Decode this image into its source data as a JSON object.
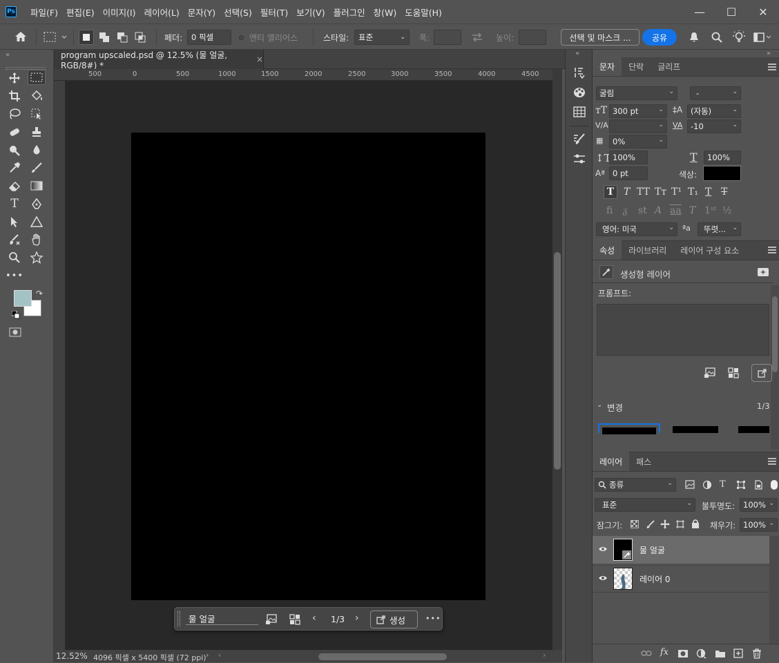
{
  "app": {
    "logo": "Ps"
  },
  "menu": [
    "파일(F)",
    "편집(E)",
    "이미지(I)",
    "레이어(L)",
    "문자(Y)",
    "선택(S)",
    "필터(T)",
    "보기(V)",
    "플러그인",
    "창(W)",
    "도움말(H)"
  ],
  "window": {
    "minimize": "—",
    "maximize": "☐",
    "close": "✕"
  },
  "options": {
    "feather_label": "페더:",
    "feather_value": "0 픽셀",
    "antialias_label": "앤티 앨리어스",
    "style_label": "스타일:",
    "style_value": "표준",
    "width_label": "폭:",
    "height_label": "높이:",
    "select_mask": "선택 및 마스크 ...",
    "share": "공유"
  },
  "document": {
    "tab_title": "program upscaled.psd @ 12.5% (물 얼굴, RGB/8#) *",
    "ruler_ticks": [
      "500",
      "0",
      "500",
      "1000",
      "1500",
      "2000",
      "2500",
      "3000",
      "3500",
      "4000",
      "4500"
    ],
    "zoom": "12.52%",
    "info": "4096 픽셀 x 5400 픽셀 (72 ppi)"
  },
  "contextual_bar": {
    "prompt": "물 얼굴",
    "pager": "1/3",
    "generate": "생성",
    "more": "•••"
  },
  "type_panel": {
    "tabs": [
      "문자",
      "단락",
      "글리프"
    ],
    "font_family": "굴림",
    "font_style": "-",
    "size": "300 pt",
    "leading": "(자동)",
    "kerning": "",
    "tracking": "-10",
    "tsume": "0%",
    "vscale": "100%",
    "hscale": "100%",
    "baseline": "0 pt",
    "color_label": "색상:",
    "color": "#000000",
    "language": "영어: 미국",
    "antialias_glyph": "ªa",
    "antialias": "뚜렷..."
  },
  "props_panel": {
    "tabs": [
      "속성",
      "라이브러리",
      "레이어 구성 요소"
    ],
    "layer_type": "생성형 레이어",
    "prompt_label": "프롬프트:",
    "prompt_value": "",
    "variations_label": "변경",
    "variations_count": "1/3"
  },
  "layers_panel": {
    "tabs": [
      "레이어",
      "패스"
    ],
    "filter": "종류",
    "blend": "표준",
    "opacity_label": "불투명도:",
    "opacity": "100%",
    "lock_label": "잠그기:",
    "fill_label": "채우기:",
    "fill": "100%",
    "layers": [
      {
        "name": "물 얼굴",
        "selected": true
      },
      {
        "name": "레이어 0",
        "selected": false
      }
    ]
  },
  "colors": {
    "foreground": "#a3c2c3",
    "background": "#ffffff",
    "accent": "#1473e6"
  }
}
